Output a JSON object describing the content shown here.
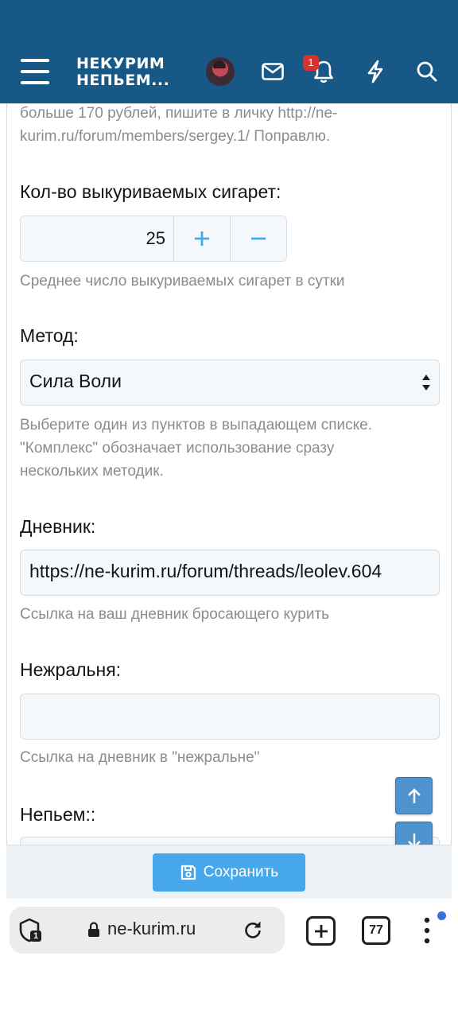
{
  "header": {
    "logo_line1": "НЕКУРИМ",
    "logo_line2": "НЕПЬЕМ...",
    "notification_count": "1",
    "icons": [
      "menu-icon",
      "avatar",
      "mail-icon",
      "bell-icon",
      "lightning-icon",
      "search-icon"
    ]
  },
  "form": {
    "intro_line1": "больше 170 рублей, пишите в личку http://ne-",
    "intro_line2": "kurim.ru/forum/members/sergey.1/ Поправлю.",
    "cigarettes": {
      "label": "Кол-во выкуриваемых сигарет:",
      "value": "25",
      "hint": "Среднее число выкуриваемых сигарет в сутки"
    },
    "method": {
      "label": "Метод:",
      "value": "Сила Воли",
      "hint_line1": "Выберите один из пунктов в выпадающем списке.",
      "hint_line2": "\"Комплекс\" обозначает использование сразу",
      "hint_line3": "нескольких методик."
    },
    "diary": {
      "label": "Дневник:",
      "value": "https://ne-kurim.ru/forum/threads/leolev.604",
      "hint": "Ссылка на ваш дневник бросающего курить"
    },
    "nezhralnya": {
      "label": "Нежральня:",
      "value": "",
      "hint": "Ссылка на дневник в \"нежральне\""
    },
    "nepyem": {
      "label": "Непьем::"
    },
    "save_label": "Сохранить"
  },
  "browser": {
    "url": "ne-kurim.ru",
    "tab_count": "77",
    "shield_badge": "1"
  },
  "colors": {
    "header_bg": "#185886",
    "accent": "#47a7eb",
    "badge": "#d9312f",
    "scroll_button": "#4e93cd"
  }
}
